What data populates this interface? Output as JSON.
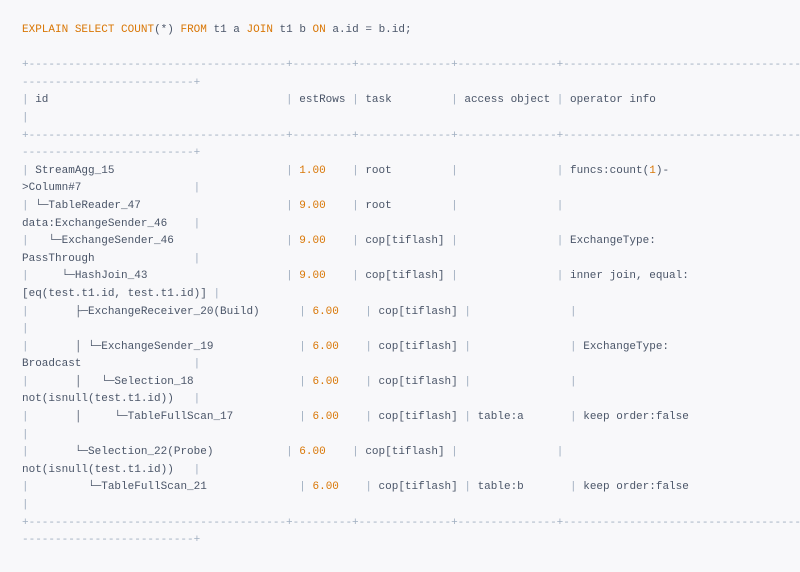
{
  "query": {
    "explain": "EXPLAIN",
    "select": "SELECT",
    "count": "COUNT",
    "star": "*",
    "from": "FROM",
    "t1a": "t1 a",
    "join": "JOIN",
    "t1b": "t1 b",
    "on": "ON",
    "cond": "a.id = b.id",
    "semi": ";"
  },
  "hdr": {
    "id": "id",
    "estRows": "estRows",
    "task": "task",
    "access": "access object",
    "info": "operator info"
  },
  "rows": [
    {
      "id": "StreamAgg_15",
      "est": "1.00",
      "task": "root",
      "acc": "",
      "info": "funcs:count(",
      "infoNum": "1",
      "info2": ")-",
      "cont": ">Column#7"
    },
    {
      "id": "└─TableReader_47",
      "est": "9.00",
      "task": "root",
      "acc": "",
      "info": "",
      "cont": "data:ExchangeSender_46"
    },
    {
      "id": "  └─ExchangeSender_46",
      "est": "9.00",
      "task": "cop[tiflash]",
      "acc": "",
      "info": "ExchangeType: ",
      "cont": "PassThrough"
    },
    {
      "id": "    └─HashJoin_43",
      "est": "9.00",
      "task": "cop[tiflash]",
      "acc": "",
      "info": "inner join, equal:",
      "cont": "[eq(test.t1.id, test.t1.id)]"
    },
    {
      "id": "      ├─ExchangeReceiver_20(Build)",
      "est": "6.00",
      "task": "cop[tiflash]",
      "acc": "",
      "info": ""
    },
    {
      "id": "      │ └─ExchangeSender_19",
      "est": "6.00",
      "task": "cop[tiflash]",
      "acc": "",
      "info": "ExchangeType: ",
      "cont": "Broadcast"
    },
    {
      "id": "      │   └─Selection_18",
      "est": "6.00",
      "task": "cop[tiflash]",
      "acc": "",
      "info": "",
      "cont": "not(isnull(test.t1.id))"
    },
    {
      "id": "      │     └─TableFullScan_17",
      "est": "6.00",
      "task": "cop[tiflash]",
      "acc": "table:a",
      "info": "keep order:false"
    },
    {
      "id": "      └─Selection_22(Probe)",
      "est": "6.00",
      "task": "cop[tiflash]",
      "acc": "",
      "info": "",
      "cont": "not(isnull(test.t1.id))"
    },
    {
      "id": "        └─TableFullScan_21",
      "est": "6.00",
      "task": "cop[tiflash]",
      "acc": "table:b",
      "info": "keep order:false"
    }
  ],
  "sep": {
    "long": "+---------------------------------------+---------+--------------+---------------+---------------------------------------+",
    "longCont": "--------------------------+"
  }
}
